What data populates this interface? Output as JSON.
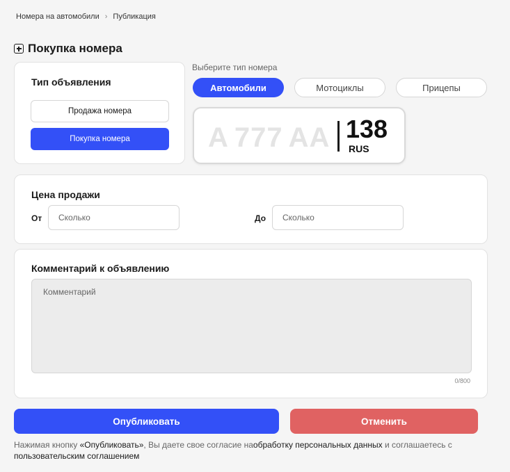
{
  "breadcrumb": {
    "items": [
      "Номера на автомобили",
      "Публикация"
    ]
  },
  "page": {
    "title": "Покупка номера",
    "title_icon": "plus-square-icon"
  },
  "listing_type": {
    "heading": "Тип объявления",
    "options": [
      "Продажа номера",
      "Покупка номера"
    ],
    "selected": "Покупка номера"
  },
  "plate_type": {
    "label": "Выберите тип номера",
    "tabs": [
      "Автомобили",
      "Мотоциклы",
      "Прицепы"
    ],
    "selected": "Автомобили"
  },
  "plate": {
    "letter1": "А",
    "digits": "777",
    "letters2": "АА",
    "region": "138",
    "country": "RUS"
  },
  "price": {
    "heading": "Цена продажи",
    "from_label": "От",
    "to_label": "До",
    "from_placeholder": "Сколько",
    "to_placeholder": "Сколько"
  },
  "comment": {
    "heading": "Комментарий к объявлению",
    "placeholder": "Комментарий",
    "counter": "0/800"
  },
  "actions": {
    "publish": "Опубликовать",
    "cancel": "Отменить"
  },
  "consent": {
    "prefix": "Нажимая кнопку ",
    "button_ref": "«Опубликовать»",
    "middle": ", Вы даете свое согласие на",
    "link1": "обработку персональных данных",
    "middle2": " и соглашаетесь с ",
    "link2": "пользовательским соглашением"
  },
  "colors": {
    "primary": "#3350f7",
    "danger": "#e06262",
    "background": "#f5f5f5"
  }
}
